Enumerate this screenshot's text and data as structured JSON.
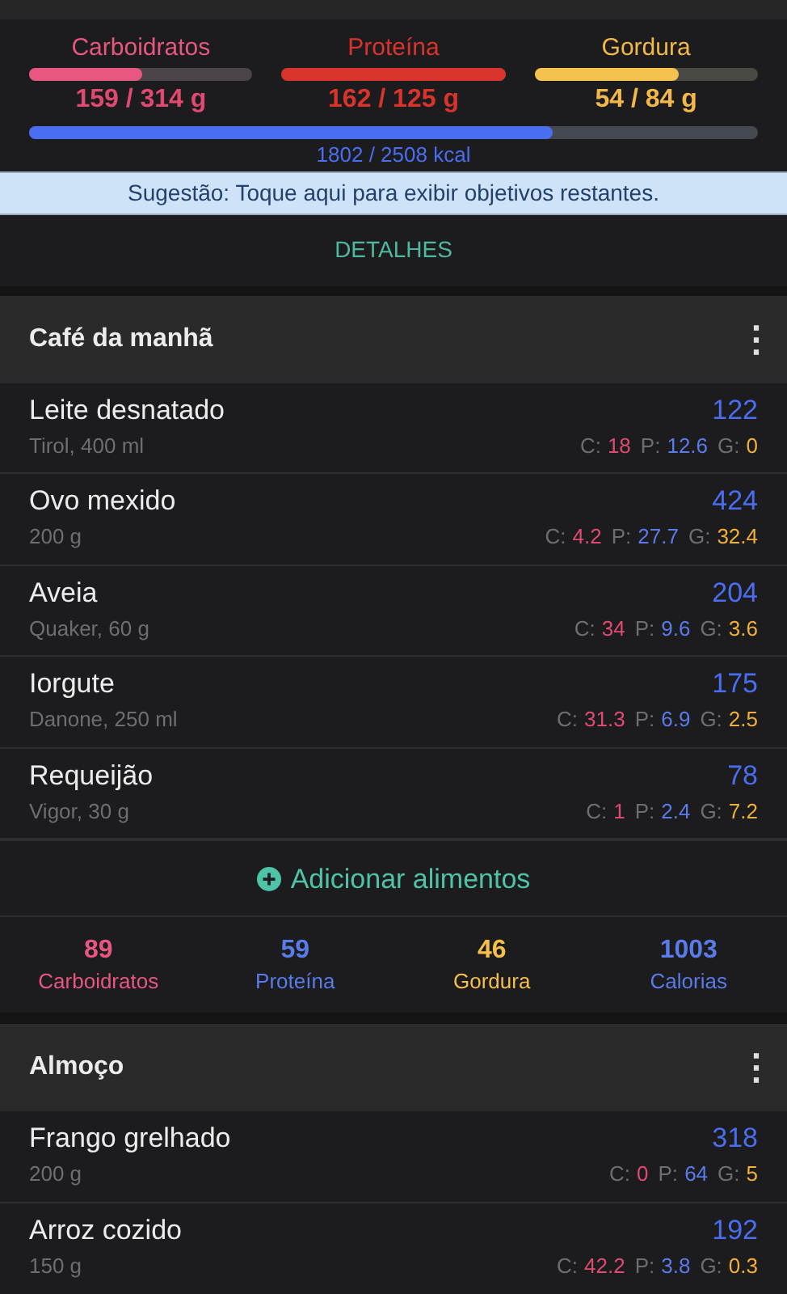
{
  "goals": [
    {
      "kind": "carb",
      "label": "Carboidratos",
      "level": 0.506,
      "value": "159 / 314 g"
    },
    {
      "kind": "protein",
      "label": "Proteína",
      "level": 1,
      "value": "162 / 125 g"
    },
    {
      "kind": "fat",
      "label": "Gordura",
      "level": 0.643,
      "value": "54 / 84 g"
    }
  ],
  "calories": {
    "level": 0.718,
    "value": "1802 / 2508 kcal"
  },
  "suggestion": "Sugestão: Toque aqui para exibir objetivos restantes.",
  "details_button": "DETALHES",
  "meals": [
    {
      "title": "Café da manhã",
      "menu": "⋮",
      "foods": [
        {
          "name": "Leite desnatado",
          "detail": "Tirol, 400 ml",
          "kcal": "122",
          "macros": [
            {
              "kind": "carb",
              "label": "C:",
              "value": "18"
            },
            {
              "kind": "protein",
              "label": "P:",
              "value": "12.6"
            },
            {
              "kind": "fat",
              "label": "G:",
              "value": "0"
            }
          ]
        },
        {
          "name": "Ovo mexido",
          "detail": "200 g",
          "kcal": "424",
          "macros": [
            {
              "kind": "carb",
              "label": "C:",
              "value": "4.2"
            },
            {
              "kind": "protein",
              "label": "P:",
              "value": "27.7"
            },
            {
              "kind": "fat",
              "label": "G:",
              "value": "32.4"
            }
          ]
        },
        {
          "name": "Aveia",
          "detail": "Quaker, 60 g",
          "kcal": "204",
          "macros": [
            {
              "kind": "carb",
              "label": "C:",
              "value": "34"
            },
            {
              "kind": "protein",
              "label": "P:",
              "value": "9.6"
            },
            {
              "kind": "fat",
              "label": "G:",
              "value": "3.6"
            }
          ]
        },
        {
          "name": "Iorgute",
          "detail": "Danone, 250 ml",
          "kcal": "175",
          "macros": [
            {
              "kind": "carb",
              "label": "C:",
              "value": "31.3"
            },
            {
              "kind": "protein",
              "label": "P:",
              "value": "6.9"
            },
            {
              "kind": "fat",
              "label": "G:",
              "value": "2.5"
            }
          ]
        },
        {
          "name": "Requeijão",
          "detail": "Vigor, 30 g",
          "kcal": "78",
          "macros": [
            {
              "kind": "carb",
              "label": "C:",
              "value": "1"
            },
            {
              "kind": "protein",
              "label": "P:",
              "value": "2.4"
            },
            {
              "kind": "fat",
              "label": "G:",
              "value": "7.2"
            }
          ]
        }
      ],
      "add_button": "Adicionar alimentos",
      "totals": [
        {
          "kind": "carb",
          "value": "89",
          "label": "Carboidratos"
        },
        {
          "kind": "protein",
          "value": "59",
          "label": "Proteína"
        },
        {
          "kind": "fat",
          "value": "46",
          "label": "Gordura"
        },
        {
          "kind": "kcal",
          "value": "1003",
          "label": "Calorias"
        }
      ]
    },
    {
      "title": "Almoço",
      "menu": "⋮",
      "foods": [
        {
          "name": "Frango grelhado",
          "detail": "200 g",
          "kcal": "318",
          "macros": [
            {
              "kind": "carb",
              "label": "C:",
              "value": "0"
            },
            {
              "kind": "protein",
              "label": "P:",
              "value": "64"
            },
            {
              "kind": "fat",
              "label": "G:",
              "value": "5"
            }
          ]
        },
        {
          "name": "Arroz cozido",
          "detail": "150 g",
          "kcal": "192",
          "macros": [
            {
              "kind": "carb",
              "label": "C:",
              "value": "42.2"
            },
            {
              "kind": "protein",
              "label": "P:",
              "value": "3.8"
            },
            {
              "kind": "fat",
              "label": "G:",
              "value": "0.3"
            }
          ]
        }
      ]
    }
  ]
}
